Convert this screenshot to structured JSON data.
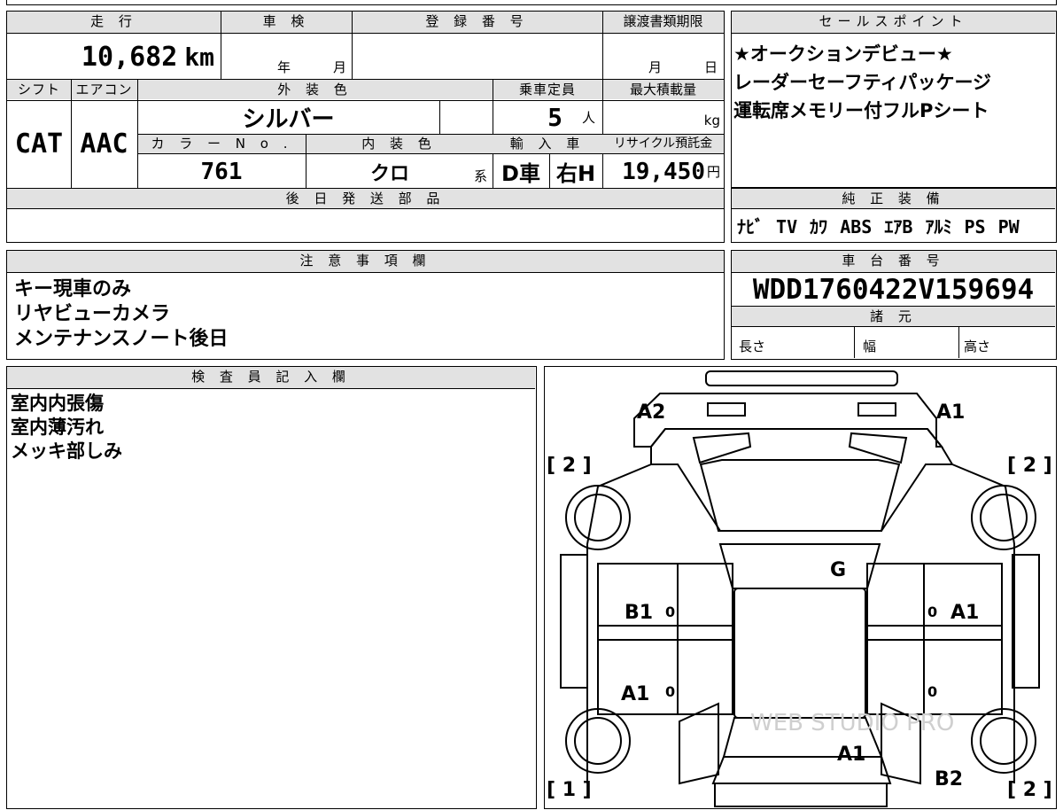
{
  "main": {
    "h_mileage": "走 行",
    "h_inspection": "車 検",
    "h_reg": "登 録 番 号",
    "h_transfer": "譲渡書類期限",
    "mileage": "10,682",
    "mileage_unit": "km",
    "insp_year": "年",
    "insp_month": "月",
    "transfer_month": "月",
    "transfer_day": "日",
    "h_shift": "シフト",
    "h_ac": "エアコン",
    "h_exterior": "外 装 色",
    "h_capacity": "乗車定員",
    "h_maxload": "最大積載量",
    "shift": "CAT",
    "ac": "AAC",
    "exterior_color": "シルバー",
    "capacity": "5",
    "capacity_unit": "人",
    "maxload_unit": "kg",
    "h_colorno": "カ ラ ー N o .",
    "h_interior": "内 装 色",
    "h_import": "輸 入 車",
    "h_recycle": "リサイクル預託金",
    "color_no": "761",
    "interior_color": "クロ",
    "interior_suffix": "系",
    "import_type": "D車",
    "steering": "右H",
    "recycle_fee": "19,450",
    "recycle_unit": "円",
    "h_later_parts": "後 日 発 送 部 品"
  },
  "sales": {
    "header": "セールスポイント",
    "lines": [
      "★オークションデビュー★",
      "レーダーセーフティパッケージ",
      "運転席メモリー付フルPシート"
    ]
  },
  "equipment": {
    "header": "純 正 装 備",
    "items": "ﾅﾋﾞ TV ｶﾜ ABS ｴｱB ｱﾙﾐ PS PW"
  },
  "notes": {
    "header": "注 意 事 項 欄",
    "lines": [
      "キー現車のみ",
      "リヤビューカメラ",
      "メンテナンスノート後日"
    ]
  },
  "chassis": {
    "header": "車 台 番 号",
    "vin": "WDD1760422V159694",
    "spec_header": "諸 元",
    "length": "長さ",
    "width": "幅",
    "height": "高さ"
  },
  "inspector": {
    "header": "検 査 員 記 入 欄",
    "lines": [
      "室内内張傷",
      "室内薄汚れ",
      "メッキ部しみ"
    ]
  },
  "diagram": {
    "front_left": "A2",
    "front_right": "A1",
    "tire_fl": "[ 2 ]",
    "tire_fr": "[ 2 ]",
    "tire_rl": "[ 1 ]",
    "tire_rr": "[ 2 ]",
    "windshield": "G",
    "door_fl": "B1",
    "door_fr": "A1",
    "door_rl": "A1",
    "rear": "A1",
    "rear_right": "B2",
    "zero": "0",
    "watermark": "WEB STUDIO PRO"
  }
}
